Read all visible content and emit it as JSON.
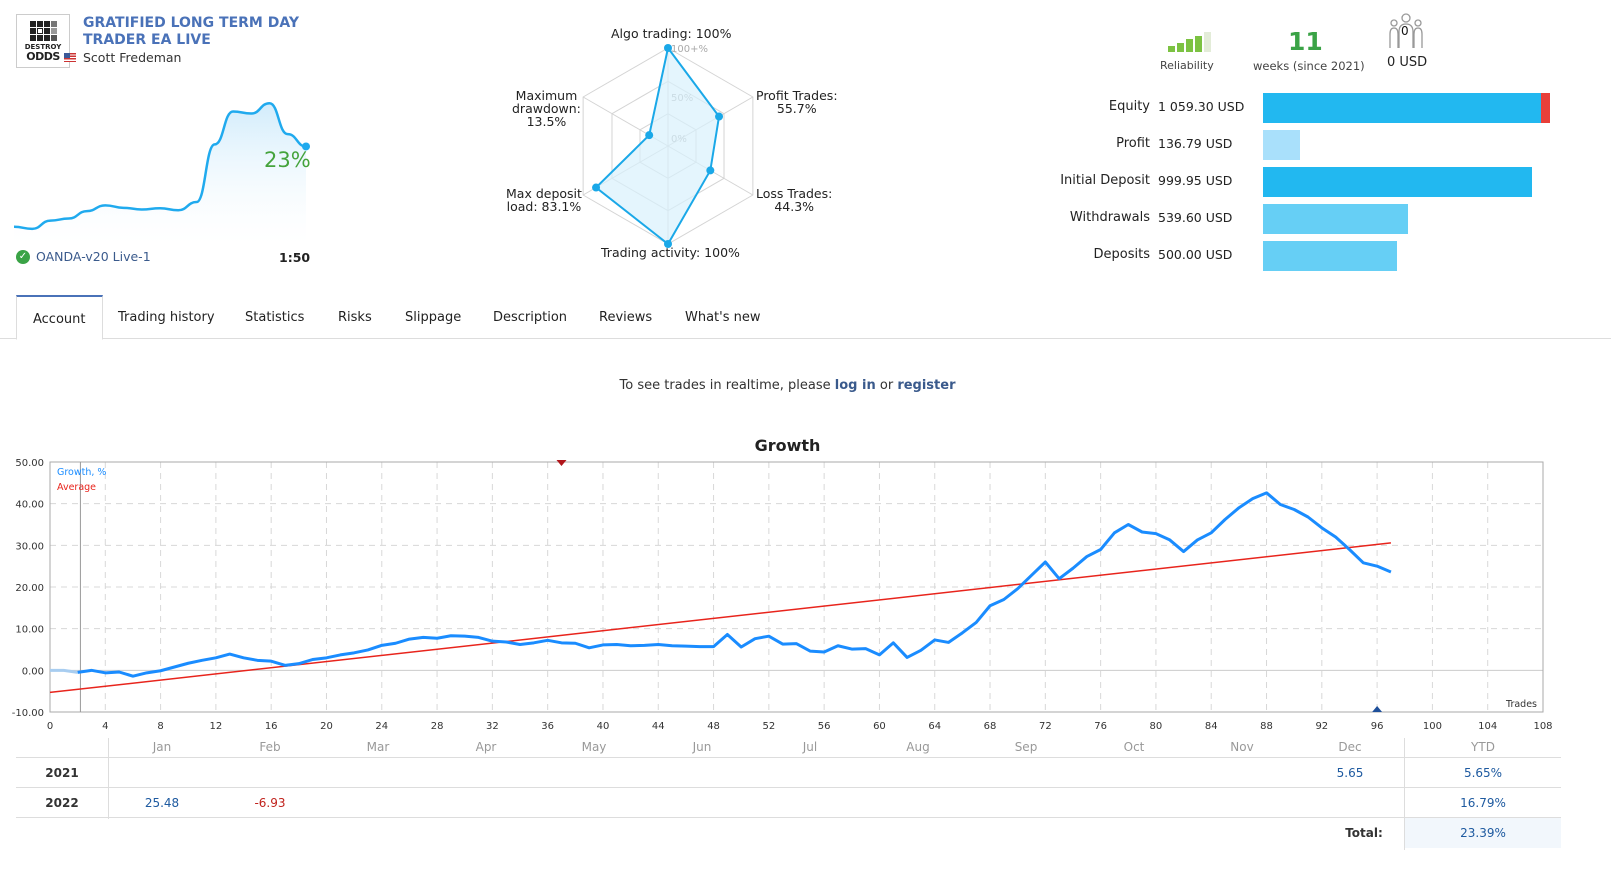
{
  "header": {
    "logo_text_top": "DESTROY",
    "logo_text_bottom": "ODDS",
    "title": "GRATIFIED LONG TERM DAY TRADER EA LIVE",
    "author": "Scott Fredeman",
    "growth_percent": "23%",
    "server": "OANDA-v20 Live-1",
    "leverage": "1:50"
  },
  "mini_chart": {
    "values": [
      0.0,
      -0.5,
      1.5,
      2.0,
      3.8,
      5.2,
      4.6,
      4.2,
      4.5,
      4.0,
      6.0,
      20.0,
      28.0,
      27.5,
      30.0,
      22.5,
      19.5
    ]
  },
  "radar": {
    "scale_labels": [
      "100+%",
      "50%",
      "0%"
    ],
    "axes": [
      {
        "label": "Algo trading: 100%",
        "value": 100
      },
      {
        "label": "Profit Trades: 55.7%",
        "value": 55.7
      },
      {
        "label": "Loss Trades: 44.3%",
        "value": 44.3
      },
      {
        "label": "Trading activity: 100%",
        "value": 100
      },
      {
        "label": "Max deposit load: 83.1%",
        "value": 83.1
      },
      {
        "label": "Maximum drawdown: 13.5%",
        "value": 13.5
      }
    ],
    "labels": {
      "algo": "Algo trading: 100%",
      "profit_1": "Profit Trades:",
      "profit_2": "55.7%",
      "loss_1": "Loss Trades:",
      "loss_2": "44.3%",
      "activity": "Trading activity: 100%",
      "deposit_1": "Max deposit",
      "deposit_2": "load: 83.1%",
      "drawdown_1": "Maximum",
      "drawdown_2": "drawdown:",
      "drawdown_3": "13.5%"
    }
  },
  "stats": {
    "reliability_label": "Reliability",
    "reliability_level": 4,
    "reliability_max": 5,
    "weeks": "11",
    "weeks_label": "weeks (since 2021)",
    "subscribers": "0",
    "subscribers_usd": "0 USD",
    "bars": [
      {
        "label": "Equity",
        "value": "1 059.30 USD",
        "amount": 1059.3,
        "color": "#22b8f0",
        "overflow_color": "#e8403a"
      },
      {
        "label": "Profit",
        "value": "136.79 USD",
        "amount": 136.79,
        "color": "#a9e0fb"
      },
      {
        "label": "Initial Deposit",
        "value": "999.95 USD",
        "amount": 999.95,
        "color": "#22b8f0"
      },
      {
        "label": "Withdrawals",
        "value": "539.60 USD",
        "amount": 539.6,
        "color": "#66cff5"
      },
      {
        "label": "Deposits",
        "value": "500.00 USD",
        "amount": 500.0,
        "color": "#66cff5"
      }
    ]
  },
  "tabs": [
    {
      "label": "Account",
      "active": true
    },
    {
      "label": "Trading history",
      "active": false
    },
    {
      "label": "Statistics",
      "active": false
    },
    {
      "label": "Risks",
      "active": false
    },
    {
      "label": "Slippage",
      "active": false
    },
    {
      "label": "Description",
      "active": false
    },
    {
      "label": "Reviews",
      "active": false
    },
    {
      "label": "What's new",
      "active": false
    }
  ],
  "notice": {
    "prefix": "To see trades in realtime, please",
    "login": "log in",
    "or": "or",
    "register": "register"
  },
  "chart_data": {
    "type": "line",
    "title": "Growth",
    "xlabel": "Trades",
    "ylabel": "",
    "xlim": [
      0,
      108
    ],
    "ylim": [
      -10,
      50
    ],
    "x_ticks": [
      0,
      4,
      8,
      12,
      16,
      20,
      24,
      28,
      32,
      36,
      40,
      44,
      48,
      52,
      56,
      60,
      64,
      68,
      72,
      76,
      80,
      84,
      88,
      92,
      96,
      100,
      104,
      108
    ],
    "y_ticks": [
      "-10.00",
      "0.00",
      "10.00",
      "20.00",
      "30.00",
      "40.00",
      "50.00"
    ],
    "grid": true,
    "legend": [
      {
        "name": "Growth, %",
        "color": "#1a8cff"
      },
      {
        "name": "Average",
        "color": "#e8241c"
      }
    ],
    "legend_position": "top-left",
    "series": [
      {
        "name": "Growth, %",
        "pre_points": [
          [
            0,
            0.0
          ],
          [
            1,
            0.0
          ],
          [
            2,
            -0.5
          ]
        ],
        "points": [
          [
            2,
            -0.5
          ],
          [
            3,
            0.0
          ],
          [
            4,
            -0.6
          ],
          [
            5,
            -0.4
          ],
          [
            6,
            -1.4
          ],
          [
            7,
            -0.6
          ],
          [
            8,
            -0.1
          ],
          [
            9,
            0.8
          ],
          [
            10,
            1.7
          ],
          [
            11,
            2.4
          ],
          [
            12,
            3.0
          ],
          [
            13,
            3.9
          ],
          [
            14,
            3.0
          ],
          [
            15,
            2.4
          ],
          [
            16,
            2.2
          ],
          [
            17,
            1.2
          ],
          [
            18,
            1.6
          ],
          [
            19,
            2.6
          ],
          [
            20,
            3.0
          ],
          [
            21,
            3.7
          ],
          [
            22,
            4.2
          ],
          [
            23,
            4.9
          ],
          [
            24,
            6.0
          ],
          [
            25,
            6.5
          ],
          [
            26,
            7.5
          ],
          [
            27,
            7.9
          ],
          [
            28,
            7.7
          ],
          [
            29,
            8.3
          ],
          [
            30,
            8.2
          ],
          [
            31,
            7.9
          ],
          [
            32,
            7.0
          ],
          [
            33,
            6.8
          ],
          [
            34,
            6.2
          ],
          [
            35,
            6.6
          ],
          [
            36,
            7.2
          ],
          [
            37,
            6.6
          ],
          [
            38,
            6.5
          ],
          [
            39,
            5.4
          ],
          [
            40,
            6.1
          ],
          [
            41,
            6.2
          ],
          [
            42,
            5.9
          ],
          [
            43,
            6.0
          ],
          [
            44,
            6.2
          ],
          [
            45,
            5.9
          ],
          [
            46,
            5.8
          ],
          [
            47,
            5.7
          ],
          [
            48,
            5.7
          ],
          [
            49,
            8.6
          ],
          [
            50,
            5.6
          ],
          [
            51,
            7.6
          ],
          [
            52,
            8.2
          ],
          [
            53,
            6.3
          ],
          [
            54,
            6.4
          ],
          [
            55,
            4.6
          ],
          [
            56,
            4.4
          ],
          [
            57,
            5.9
          ],
          [
            58,
            5.1
          ],
          [
            59,
            5.2
          ],
          [
            60,
            3.7
          ],
          [
            61,
            6.6
          ],
          [
            62,
            3.1
          ],
          [
            63,
            4.8
          ],
          [
            64,
            7.3
          ],
          [
            65,
            6.7
          ],
          [
            66,
            9.0
          ],
          [
            67,
            11.5
          ],
          [
            68,
            15.5
          ],
          [
            69,
            17.0
          ],
          [
            70,
            19.6
          ],
          [
            71,
            22.8
          ],
          [
            72,
            26.0
          ],
          [
            73,
            22.0
          ],
          [
            74,
            24.5
          ],
          [
            75,
            27.3
          ],
          [
            76,
            29.0
          ],
          [
            77,
            33.0
          ],
          [
            78,
            35.0
          ],
          [
            79,
            33.2
          ],
          [
            80,
            32.8
          ],
          [
            81,
            31.3
          ],
          [
            82,
            28.5
          ],
          [
            83,
            31.3
          ],
          [
            84,
            33.0
          ],
          [
            85,
            36.2
          ],
          [
            86,
            39.0
          ],
          [
            87,
            41.2
          ],
          [
            88,
            42.6
          ],
          [
            89,
            39.8
          ],
          [
            90,
            38.6
          ],
          [
            91,
            36.8
          ],
          [
            92,
            34.2
          ],
          [
            93,
            32.0
          ],
          [
            94,
            29.0
          ],
          [
            95,
            25.8
          ],
          [
            96,
            25.0
          ],
          [
            97,
            23.6
          ]
        ]
      },
      {
        "name": "Average",
        "points": [
          [
            0,
            -5.3
          ],
          [
            97,
            30.6
          ]
        ]
      }
    ],
    "markers": [
      {
        "type": "down-arrow",
        "x": 37,
        "color": "#b0151a",
        "position": "top"
      },
      {
        "type": "up-arrow",
        "x": 96,
        "color": "#1e4f9a",
        "position": "bottom"
      }
    ]
  },
  "monthly_table": {
    "columns": [
      "Jan",
      "Feb",
      "Mar",
      "Apr",
      "May",
      "Jun",
      "Jul",
      "Aug",
      "Sep",
      "Oct",
      "Nov",
      "Dec",
      "YTD"
    ],
    "rows": [
      {
        "year": "2021",
        "values": [
          "",
          "",
          "",
          "",
          "",
          "",
          "",
          "",
          "",
          "",
          "",
          "5.65"
        ],
        "ytd": "5.65%"
      },
      {
        "year": "2022",
        "values": [
          "25.48",
          "-6.93",
          "",
          "",
          "",
          "",
          "",
          "",
          "",
          "",
          "",
          ""
        ],
        "ytd": "16.79%"
      }
    ],
    "total_label": "Total:",
    "total_value": "23.39%"
  }
}
